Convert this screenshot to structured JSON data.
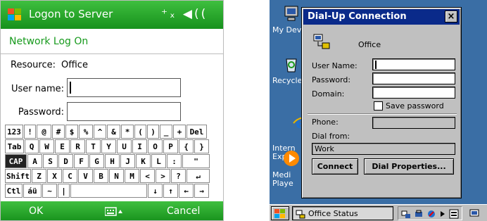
{
  "left_device": {
    "titlebar": {
      "title": "Logon to Server",
      "status_icons": "⁺ₓ ◀(("
    },
    "subtitle": "Network Log On",
    "resource": {
      "label": "Resource:",
      "value": "Office"
    },
    "username": {
      "label": "User name:",
      "value": ""
    },
    "password": {
      "label": "Password:",
      "value": ""
    },
    "keyboard": {
      "row1": [
        "123",
        "!",
        "@",
        "#",
        "$",
        "%",
        "^",
        "&",
        "*",
        "(",
        ")",
        "_",
        "+",
        "Del"
      ],
      "row2": [
        "Tab",
        "Q",
        "W",
        "E",
        "R",
        "T",
        "Y",
        "U",
        "I",
        "O",
        "P",
        "{",
        "}"
      ],
      "row3": [
        "CAP",
        "A",
        "S",
        "D",
        "F",
        "G",
        "H",
        "J",
        "K",
        "L",
        ":",
        "\""
      ],
      "row4": [
        "Shift",
        "Z",
        "X",
        "C",
        "V",
        "B",
        "N",
        "M",
        "<",
        ">",
        "?",
        "↵"
      ],
      "row5": [
        "Ctl",
        "áü",
        "~",
        "|",
        " ",
        "↓",
        "↑",
        "←",
        "→"
      ]
    },
    "softkeys": {
      "left": "OK",
      "right": "Cancel"
    },
    "colors": {
      "accent": "#179a1d"
    }
  },
  "right_device": {
    "desktop_icons": [
      {
        "label": "My Dev",
        "icon": "computer-icon"
      },
      {
        "label": "Recycle",
        "icon": "recycle-bin-icon"
      },
      {
        "label": "Intern\nExplor",
        "icon": "internet-explorer-icon"
      },
      {
        "label": "Medi\nPlaye",
        "icon": "media-player-icon"
      }
    ],
    "dialog": {
      "title": "Dial-Up Connection",
      "close": "×",
      "connection_name": "Office",
      "username_label": "User Name:",
      "password_label": "Password:",
      "domain_label": "Domain:",
      "save_password_label": "Save password",
      "phone_label": "Phone:",
      "dial_from_label": "Dial from:",
      "dial_from_value": "Work",
      "connect_button": "Connect",
      "dial_properties_button": "Dial Properties..."
    },
    "taskbar": {
      "task_label": "Office Status"
    },
    "colors": {
      "desktop": "#3a6ea5",
      "titlebar": "#0a2a8a",
      "face": "#c0c0c0"
    }
  }
}
